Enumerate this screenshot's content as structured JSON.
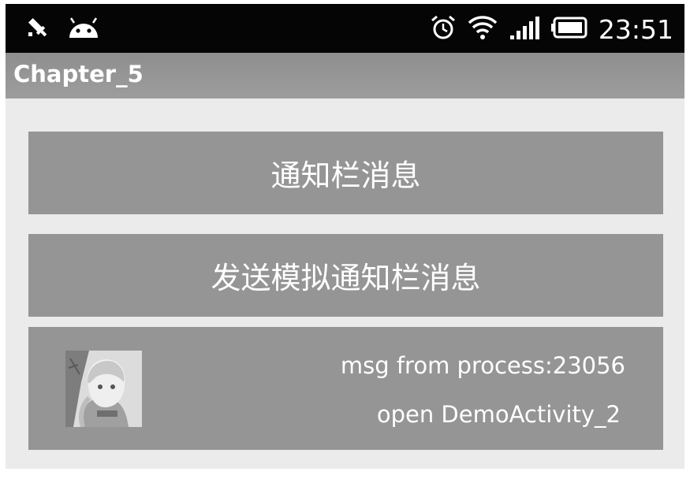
{
  "status_bar": {
    "left_icons": [
      "usb-debug-icon",
      "android-icon"
    ],
    "right_icons": [
      "alarm-icon",
      "wifi-icon",
      "signal-icon",
      "battery-icon"
    ],
    "time": "23:51"
  },
  "action_bar": {
    "title": "Chapter_5"
  },
  "buttons": {
    "notify_label": "通知栏消息",
    "send_label": "发送模拟通知栏消息"
  },
  "notification": {
    "image": "anime-girl-thumbnail",
    "message": "msg from process:23056",
    "action": "open DemoActivity_2"
  },
  "colors": {
    "status_bar_bg": "#050505",
    "action_bar_bg": "#979797",
    "button_bg": "#959595",
    "page_bg": "#ebebeb",
    "text": "#ffffff"
  }
}
